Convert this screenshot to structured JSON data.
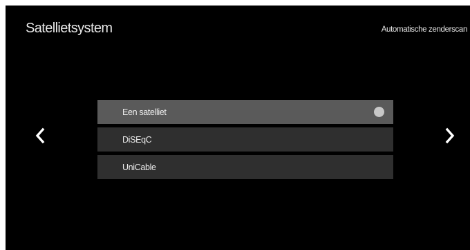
{
  "header": {
    "title": "Satellietsystem",
    "subtitle": "Automatische zenderscan"
  },
  "navigation": {
    "previous_icon": "chevron-left-icon",
    "next_icon": "chevron-right-icon"
  },
  "options": [
    {
      "label": "Een satelliet",
      "selected": true
    },
    {
      "label": "DiSEqC",
      "selected": false
    },
    {
      "label": "UniCable",
      "selected": false
    }
  ],
  "colors": {
    "background": "#000000",
    "option_bg": "#2f2f2f",
    "option_selected_bg": "#5a5a5a",
    "text": "#ececec",
    "selected_indicator": "#c8c8c8"
  }
}
